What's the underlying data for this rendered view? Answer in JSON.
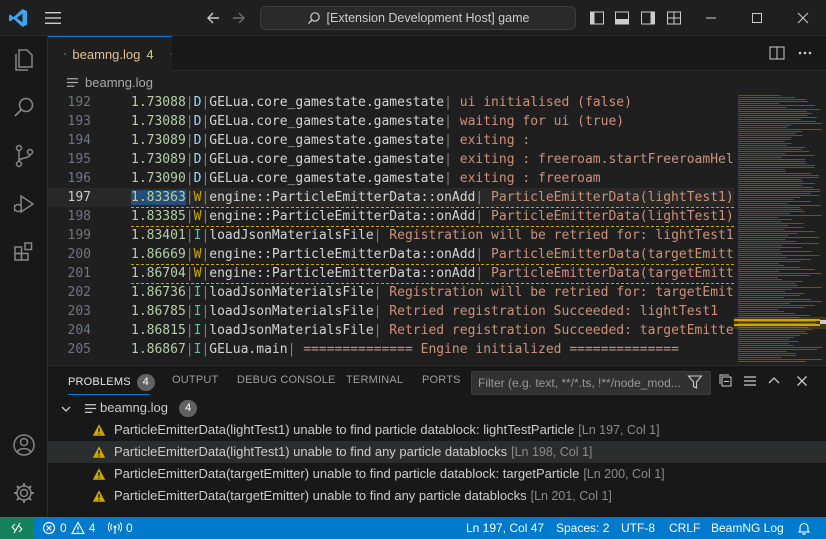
{
  "titlebar": {
    "search_text": "[Extension Development Host] game"
  },
  "tab": {
    "file_name": "beamng.log",
    "problem_count": "4"
  },
  "breadcrumb": {
    "file_name": "beamng.log"
  },
  "editor": {
    "current_line": 197,
    "lines": [
      {
        "num": "192",
        "time": "1.73088",
        "level": "D",
        "source": "GELua.core_gamestate.gamestate",
        "message": " ui initialised (false)"
      },
      {
        "num": "193",
        "time": "1.73088",
        "level": "D",
        "source": "GELua.core_gamestate.gamestate",
        "message": " waiting for ui (true)"
      },
      {
        "num": "194",
        "time": "1.73089",
        "level": "D",
        "source": "GELua.core_gamestate.gamestate",
        "message": " exiting :"
      },
      {
        "num": "195",
        "time": "1.73089",
        "level": "D",
        "source": "GELua.core_gamestate.gamestate",
        "message": " exiting : freeroam.startFreeroamHel"
      },
      {
        "num": "196",
        "time": "1.73090",
        "level": "D",
        "source": "GELua.core_gamestate.gamestate",
        "message": " exiting : freeroam"
      },
      {
        "num": "197",
        "time": "1.83363",
        "level": "W",
        "source": "engine::ParticleEmitterData::onAdd",
        "message": " ParticleEmitterData(lightTest1)"
      },
      {
        "num": "198",
        "time": "1.83385",
        "level": "W",
        "source": "engine::ParticleEmitterData::onAdd",
        "message": " ParticleEmitterData(lightTest1)"
      },
      {
        "num": "199",
        "time": "1.83401",
        "level": "I",
        "source": "loadJsonMaterialsFile",
        "message": " Registration will be retried for: lightTest1"
      },
      {
        "num": "200",
        "time": "1.86669",
        "level": "W",
        "source": "engine::ParticleEmitterData::onAdd",
        "message": " ParticleEmitterData(targetEmitt"
      },
      {
        "num": "201",
        "time": "1.86704",
        "level": "W",
        "source": "engine::ParticleEmitterData::onAdd",
        "message": " ParticleEmitterData(targetEmitt"
      },
      {
        "num": "202",
        "time": "1.86736",
        "level": "I",
        "source": "loadJsonMaterialsFile",
        "message": " Registration will be retried for: targetEmit"
      },
      {
        "num": "203",
        "time": "1.86785",
        "level": "I",
        "source": "loadJsonMaterialsFile",
        "message": " Retried registration Succeeded: lightTest1"
      },
      {
        "num": "204",
        "time": "1.86815",
        "level": "I",
        "source": "loadJsonMaterialsFile",
        "message": " Retried registration Succeeded: targetEmitte"
      },
      {
        "num": "205",
        "time": "1.86867",
        "level": "I",
        "source": "GELua.main",
        "message": " ============== Engine initialized =============="
      }
    ]
  },
  "panel": {
    "tabs": [
      {
        "label": "PROBLEMS",
        "badge": "4",
        "active": true
      },
      {
        "label": "OUTPUT"
      },
      {
        "label": "DEBUG CONSOLE"
      },
      {
        "label": "TERMINAL"
      },
      {
        "label": "PORTS"
      }
    ],
    "filter_placeholder": "Filter (e.g. text, **/*.ts, !**/node_mod...",
    "group": {
      "file_name": "beamng.log",
      "count": "4"
    },
    "problems": [
      {
        "message": "ParticleEmitterData(lightTest1) unable to find particle datablock: lightTestParticle",
        "location": "[Ln 197, Col 1]"
      },
      {
        "message": "ParticleEmitterData(lightTest1) unable to find any particle datablocks",
        "location": "[Ln 198, Col 1]"
      },
      {
        "message": "ParticleEmitterData(targetEmitter) unable to find particle datablock: targetParticle",
        "location": "[Ln 200, Col 1]"
      },
      {
        "message": "ParticleEmitterData(targetEmitter) unable to find any particle datablocks",
        "location": "[Ln 201, Col 1]"
      }
    ]
  },
  "status": {
    "errors": "0",
    "warnings": "4",
    "ports": "0",
    "position": "Ln 197, Col 47",
    "spaces": "Spaces: 2",
    "encoding": "UTF-8",
    "eol": "CRLF",
    "language": "BeamNG Log"
  },
  "colors": {
    "accent": "#0078d4",
    "statusbar": "#007acc",
    "remote": "#16825d",
    "warning": "#cca700"
  }
}
